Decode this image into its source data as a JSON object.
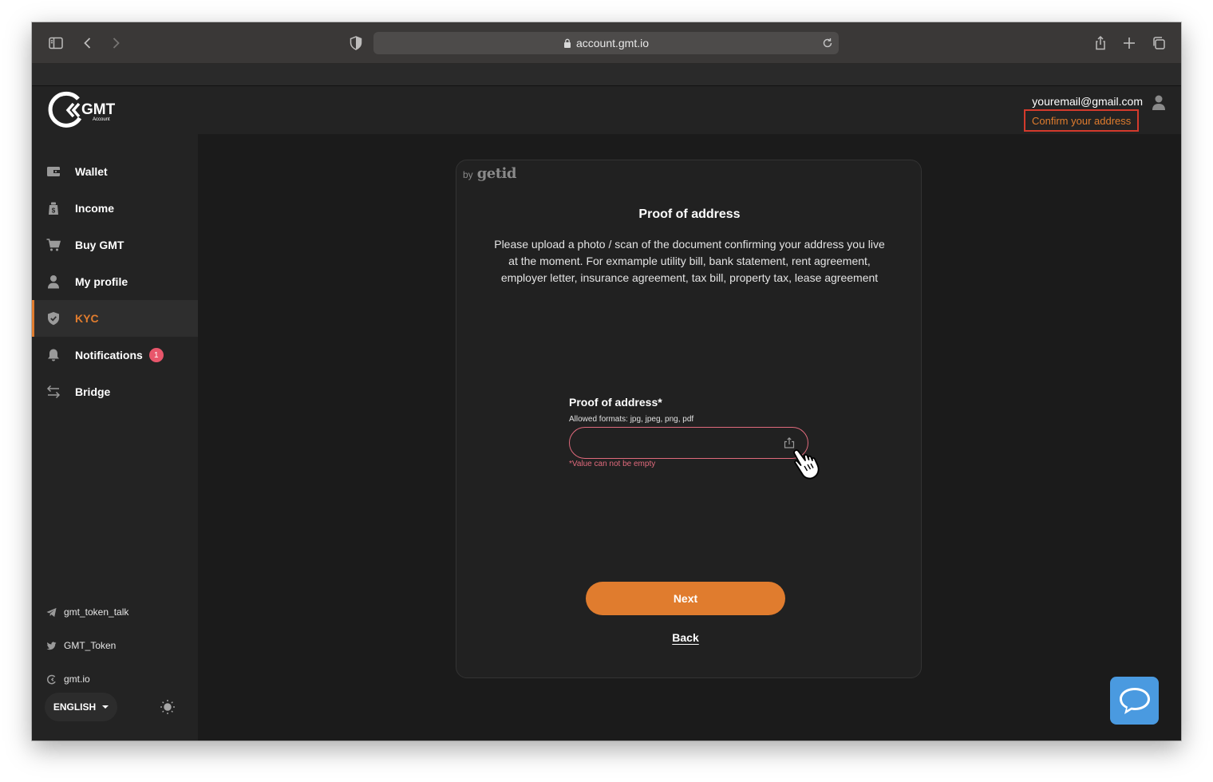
{
  "browser": {
    "url": "account.gmt.io",
    "icons": [
      "sidebar-toggle-icon",
      "back-arrow-icon",
      "forward-arrow-icon",
      "privacy-shield-icon",
      "lock-icon",
      "reload-icon",
      "share-icon",
      "new-tab-icon",
      "tab-overview-icon"
    ]
  },
  "header": {
    "logo_text": "GMT",
    "logo_subtext": "Account",
    "user_email": "youremail@gmail.com",
    "confirm_link": "Confirm your address"
  },
  "sidebar": {
    "items": [
      {
        "label": "Wallet",
        "icon": "wallet-icon"
      },
      {
        "label": "Income",
        "icon": "income-icon"
      },
      {
        "label": "Buy GMT",
        "icon": "cart-icon"
      },
      {
        "label": "My profile",
        "icon": "user-icon"
      },
      {
        "label": "KYC",
        "icon": "shield-check-icon",
        "active": true
      },
      {
        "label": "Notifications",
        "icon": "bell-icon",
        "badge": "1"
      },
      {
        "label": "Bridge",
        "icon": "swap-arrows-icon"
      }
    ],
    "social": [
      {
        "label": "gmt_token_talk",
        "icon": "telegram-icon"
      },
      {
        "label": "GMT_Token",
        "icon": "twitter-icon"
      },
      {
        "label": "gmt.io",
        "icon": "gmt-logo-icon"
      }
    ],
    "language": "ENGLISH"
  },
  "kyc_card": {
    "by_label": "by",
    "brand": "getid",
    "title": "Proof of address",
    "description": "Please upload a photo / scan of the document confirming your address you live at the moment. For exmample utility bill, bank statement, rent agreement, employer letter, insurance agreement, tax bill, property tax, lease agreement",
    "field_label": "Proof of address*",
    "field_hint": "Allowed formats: jpg, jpeg, png, pdf",
    "field_error": "*Value can not be empty",
    "next_button": "Next",
    "back_link": "Back"
  },
  "colors": {
    "accent": "#e07c2e",
    "error": "#e06a7c",
    "badge": "#e8566b",
    "chat": "#4a9ae0",
    "highlight_border": "#d33a2c"
  }
}
